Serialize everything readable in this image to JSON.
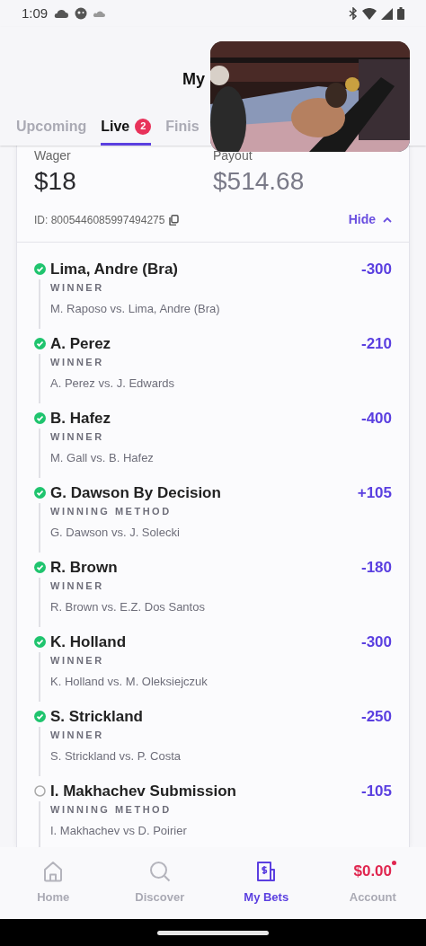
{
  "status_bar": {
    "time": "1:09"
  },
  "header": {
    "title": "My"
  },
  "tabs": [
    {
      "label": "Upcoming",
      "selected": false
    },
    {
      "label": "Live",
      "selected": true,
      "badge": "2"
    },
    {
      "label": "Finis",
      "selected": false
    }
  ],
  "bet": {
    "wager_label": "Wager",
    "wager": "$18",
    "payout_label": "Payout",
    "payout": "$514.68",
    "id": "ID: 8005446085997494275",
    "toggle": "Hide",
    "expanded": true,
    "legs": [
      {
        "settled": true,
        "selection": "Lima, Andre (Bra)",
        "market": "WINNER",
        "event": "M. Raposo vs. Lima, Andre (Bra)",
        "odds": "-300"
      },
      {
        "settled": true,
        "selection": "A. Perez",
        "market": "WINNER",
        "event": "A. Perez vs. J. Edwards",
        "odds": "-210"
      },
      {
        "settled": true,
        "selection": "B. Hafez",
        "market": "WINNER",
        "event": "M. Gall vs. B. Hafez",
        "odds": "-400"
      },
      {
        "settled": true,
        "selection": "G. Dawson By Decision",
        "market": "WINNING METHOD",
        "event": "G. Dawson vs. J. Solecki",
        "odds": "+105"
      },
      {
        "settled": true,
        "selection": "R. Brown",
        "market": "WINNER",
        "event": "R. Brown vs. E.Z. Dos Santos",
        "odds": "-180"
      },
      {
        "settled": true,
        "selection": "K. Holland",
        "market": "WINNER",
        "event": "K. Holland vs. M. Oleksiejczuk",
        "odds": "-300"
      },
      {
        "settled": true,
        "selection": "S. Strickland",
        "market": "WINNER",
        "event": "S. Strickland vs. P. Costa",
        "odds": "-250"
      },
      {
        "settled": false,
        "selection": "I. Makhachev Submission",
        "market": "WINNING METHOD",
        "event": "I. Makhachev vs D. Poirier",
        "odds": "-105"
      }
    ]
  },
  "nav": [
    {
      "kind": "home",
      "label": "Home",
      "selected": false
    },
    {
      "kind": "search",
      "label": "Discover",
      "selected": false
    },
    {
      "kind": "bets",
      "label": "My Bets",
      "selected": true
    },
    {
      "kind": "balance",
      "label": "Account",
      "balance": "$0.00",
      "selected": false
    }
  ]
}
